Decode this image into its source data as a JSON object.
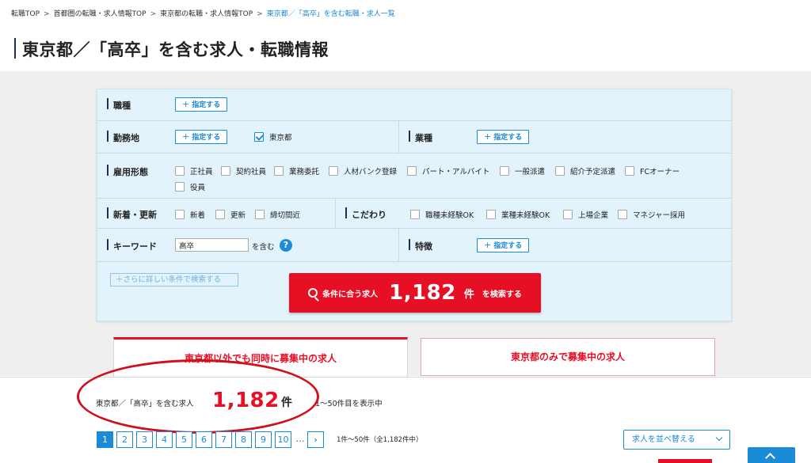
{
  "breadcrumb": {
    "items": [
      "転職TOP",
      "首都圏の転職・求人情報TOP",
      "東京都の転職・求人情報TOP"
    ],
    "current": "東京都／「高卒」を含む転職・求人一覧",
    "separator": ">"
  },
  "page_title": "東京都／「高卒」を含む求人・転職情報",
  "search": {
    "assign_label": "指定する",
    "assign_plus": "+",
    "job_type": {
      "label": "職種"
    },
    "location": {
      "label": "勤務地",
      "checked_option": "東京都"
    },
    "industry": {
      "label": "業種"
    },
    "employment": {
      "label": "雇用形態",
      "options": [
        "正社員",
        "契約社員",
        "業務委託",
        "人材バンク登録",
        "パート・アルバイト",
        "一般派遣",
        "紹介予定派遣",
        "FCオーナー",
        "役員"
      ]
    },
    "freshness": {
      "label": "新着・更新",
      "options": [
        "新着",
        "更新",
        "締切間近"
      ]
    },
    "preferences": {
      "label": "こだわり",
      "options": [
        "職種未経験OK",
        "業種未経験OK",
        "上場企業",
        "マネジャー採用"
      ]
    },
    "keyword": {
      "label": "キーワード",
      "value": "高卒",
      "suffix": "を含む",
      "help": "?"
    },
    "features": {
      "label": "特徴"
    },
    "more_conditions": "＋さらに詳しい条件で検索する",
    "button": {
      "prefix": "条件に合う求人",
      "count": "1,182",
      "unit": "件",
      "suffix": "を検索する"
    }
  },
  "tabs": [
    {
      "label": "東京都以外でも同時に募集中の求人",
      "active": true
    },
    {
      "label": "東京都のみで募集中の求人",
      "active": false
    }
  ],
  "results": {
    "label": "東京都／「高卒」を含む求人",
    "count": "1,182",
    "unit": "件",
    "range": "1〜50件目を表示中"
  },
  "pagination": {
    "pages": [
      "1",
      "2",
      "3",
      "4",
      "5",
      "6",
      "7",
      "8",
      "9",
      "10"
    ],
    "current": "1",
    "ellipsis": "…",
    "next": "›",
    "info": "1件〜50件（全1,182件中）"
  },
  "sort": {
    "label": "求人を並べ替える"
  },
  "colors": {
    "accent_blue": "#1a8bd6",
    "accent_red": "#e60f24",
    "panel_bg": "#e3f3fb",
    "navy": "#1e2f5e"
  }
}
